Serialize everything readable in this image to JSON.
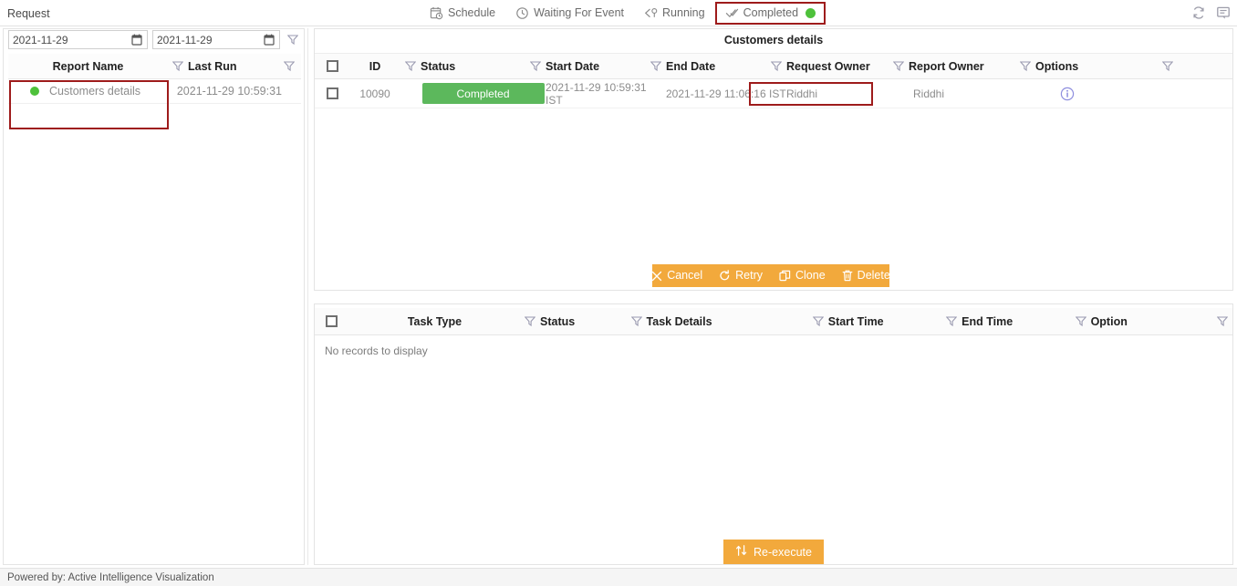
{
  "window": {
    "title": "Request"
  },
  "topbar": {
    "tabs": [
      {
        "label": "Schedule",
        "icon": "calendar-clock-icon",
        "selected": false
      },
      {
        "label": "Waiting For Event",
        "icon": "clock-icon",
        "selected": false
      },
      {
        "label": "Running",
        "icon": "running-arrow-icon",
        "selected": false
      },
      {
        "label": "Completed",
        "icon": "double-check-icon",
        "selected": true,
        "status_dot": "green"
      }
    ],
    "icons": [
      {
        "name": "refresh-icon"
      },
      {
        "name": "comment-icon"
      }
    ]
  },
  "left_panel": {
    "date_from": {
      "value": "2021-11-29",
      "placeholder": "yyyy-mm-dd"
    },
    "date_to": {
      "value": "2021-11-29",
      "placeholder": "yyyy-mm-dd"
    },
    "filter_button": "filter-icon",
    "columns": [
      "Report Name",
      "Last Run"
    ],
    "rows": [
      {
        "status_dot": "green",
        "report_name": "Customers details",
        "last_run": "2021-11-29 10:59:31"
      }
    ]
  },
  "requests_panel": {
    "title": "Customers details",
    "columns": [
      "ID",
      "Status",
      "Start Date",
      "End Date",
      "Request Owner",
      "Report Owner",
      "Options"
    ],
    "rows": [
      {
        "id": "10090",
        "status": "Completed",
        "start_date": "2021-11-29 10:59:31 IST",
        "end_date": "2021-11-29 11:06:16 IST",
        "request_owner": "Riddhi",
        "report_owner": "Riddhi",
        "options_icon": "info-icon"
      }
    ],
    "actions": [
      {
        "label": "Cancel",
        "icon": "close-icon"
      },
      {
        "label": "Retry",
        "icon": "retry-icon"
      },
      {
        "label": "Clone",
        "icon": "clone-icon"
      },
      {
        "label": "Delete",
        "icon": "trash-icon"
      }
    ]
  },
  "tasks_panel": {
    "columns": [
      "Task Type",
      "Status",
      "Task Details",
      "Start Time",
      "End Time",
      "Option"
    ],
    "empty_message": "No records to display",
    "reexecute_label": "Re-execute",
    "reexecute_icon": "swap-vertical-icon"
  },
  "footer": {
    "text": "Powered by: Active Intelligence Visualization"
  },
  "colors": {
    "accent_orange": "#f2a93c",
    "status_green": "#5cb85c",
    "dot_green": "#4ec13b",
    "highlight_red": "#9e1b1b",
    "info_blue": "#8e8ede"
  }
}
